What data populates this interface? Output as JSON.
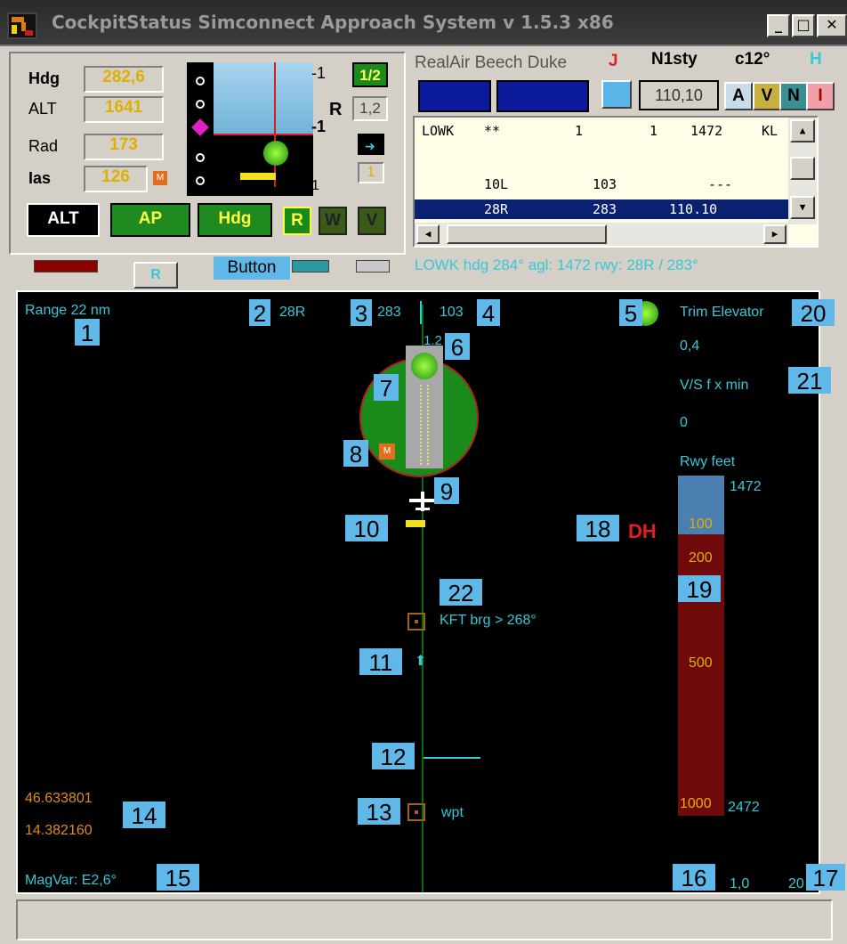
{
  "window": {
    "title": "CockpitStatus Simconnect Approach System v 1.5.3   x86",
    "btn_min": "_",
    "btn_max": "□",
    "btn_close": "✕"
  },
  "left_panel": {
    "hdg_label": "Hdg",
    "hdg_value": "282,6",
    "alt_label": "ALT",
    "alt_value": "1641",
    "rad_label": "Rad",
    "rad_value": "173",
    "ias_label": "Ias",
    "ias_value": "126",
    "scale_top": "-1",
    "scale_mid": "-1",
    "scale_bot": "1",
    "r_label": "R",
    "frac_value": "1/2",
    "ratio_value": "1,2",
    "small_value": "1",
    "m_marker": "M",
    "btn_alt": "ALT",
    "btn_ap": "AP",
    "btn_hdg": "Hdg",
    "btn_r": "R",
    "btn_w": "W",
    "btn_v": "V",
    "tab_r": "R",
    "button_label": "Button"
  },
  "right_panel": {
    "aircraft": "RealAir Beech Duke",
    "j_label": "J",
    "mode": "N1sty",
    "temp": "c12°",
    "h_label": "H",
    "freq": "110,10",
    "btn_a": "A",
    "btn_v": "V",
    "btn_n": "N",
    "btn_i": "I",
    "list_rows": [
      {
        "c1": "LOWK",
        "c2": "**",
        "c3": "1",
        "c4": "1",
        "c5": "1472",
        "c6": "KL"
      },
      {
        "c1": "",
        "c2": "",
        "c3": "",
        "c4": "",
        "c5": "",
        "c6": ""
      },
      {
        "c1": "",
        "c2": "10L",
        "c3": "103",
        "c4": "",
        "c5": "---",
        "c6": ""
      },
      {
        "c1": "",
        "c2": "28R",
        "c3": "283",
        "c4": "",
        "c5": "110.10",
        "c6": ""
      }
    ],
    "status_line": "LOWK hdg 284°   agl: 1472   rwy: 28R / 283°"
  },
  "display": {
    "range": "Range 22 nm",
    "rwy": "28R",
    "hdg1": "283",
    "hdg2": "103",
    "val_ratio": "1.2",
    "trim_label": "Trim Elevator",
    "trim_value": "0,4",
    "vs_label": "V/S  f x min",
    "vs_value": "0",
    "rwy_feet_label": "Rwy feet",
    "bar_top": "1472",
    "bar_100": "100",
    "bar_200": "200",
    "bar_500": "500",
    "bar_1000": "1000",
    "bar_bottom": "2472",
    "dh": "DH",
    "m_marker": "M",
    "kft": "KFT brg > 268°",
    "wpt": "wpt",
    "lat": "46.633801",
    "lon": "14.382160",
    "magvar": "MagVar: E2,6°",
    "scale_a": "1,0",
    "scale_b": "20"
  },
  "number_tags": [
    "1",
    "2",
    "3",
    "4",
    "5",
    "6",
    "7",
    "8",
    "9",
    "10",
    "11",
    "12",
    "13",
    "14",
    "15",
    "16",
    "17",
    "18",
    "19",
    "20",
    "21",
    "22"
  ],
  "colors": {
    "cyan": "#37c8d8",
    "green": "#1a7a1a",
    "bar_red": "#6e0a0a",
    "bar_blue": "#4a7fb0",
    "tag": "#5fb8e8"
  }
}
